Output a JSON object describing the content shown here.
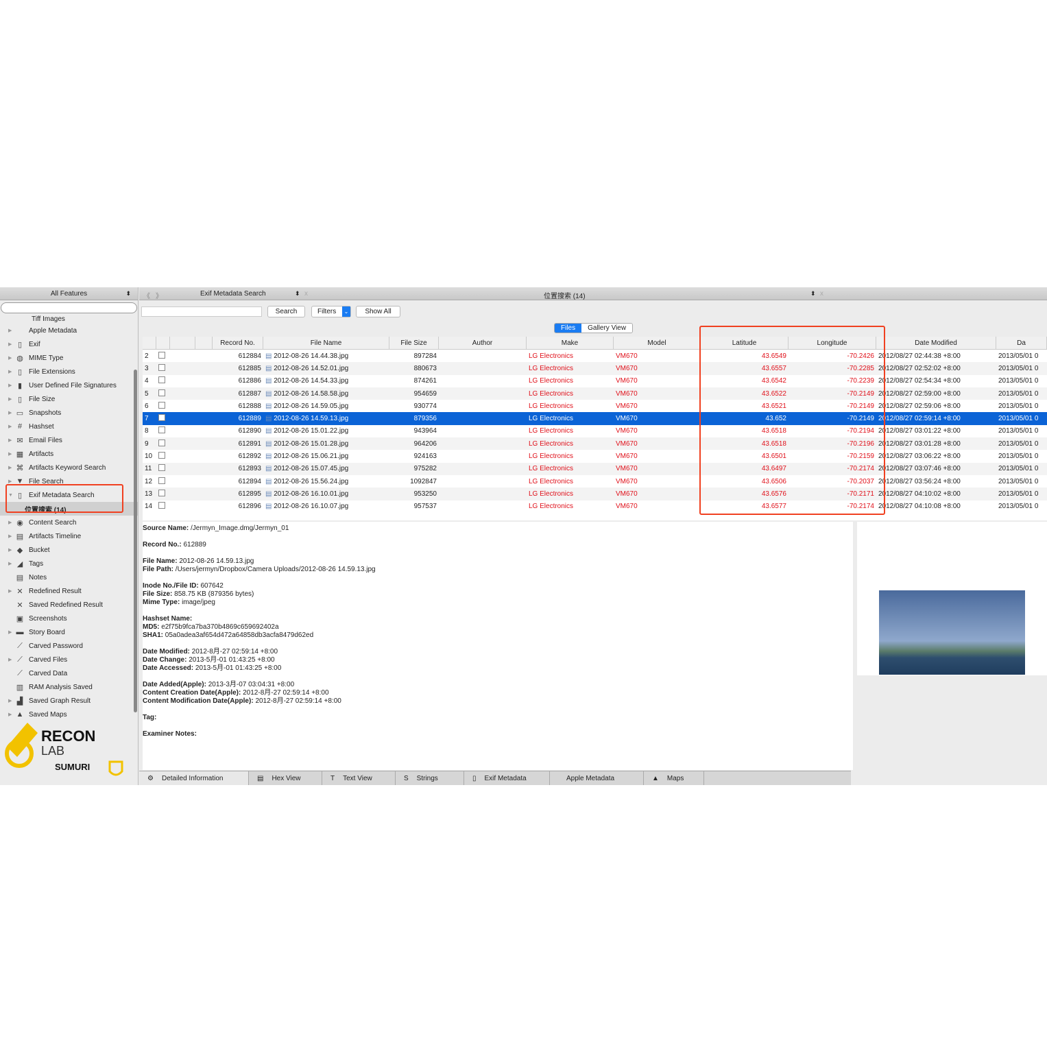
{
  "sidebar": {
    "title": "All Features",
    "partial_item": "Tiff Images",
    "items": [
      {
        "label": "Apple Metadata",
        "icon": "apple-icon",
        "g": ""
      },
      {
        "label": "Exif",
        "icon": "file-icon",
        "g": "▯"
      },
      {
        "label": "MIME Type",
        "icon": "globe-icon",
        "g": "◍"
      },
      {
        "label": "File Extensions",
        "icon": "document-icon",
        "g": "▯"
      },
      {
        "label": "User Defined File Signatures",
        "icon": "document-icon",
        "g": "▮"
      },
      {
        "label": "File Size",
        "icon": "document-icon",
        "g": "▯"
      },
      {
        "label": "Snapshots",
        "icon": "monitor-icon",
        "g": "▭"
      },
      {
        "label": "Hashset",
        "icon": "hash-icon",
        "g": "#"
      },
      {
        "label": "Email Files",
        "icon": "envelope-icon",
        "g": "✉"
      },
      {
        "label": "Artifacts",
        "icon": "grid-icon",
        "g": "▦"
      },
      {
        "label": "Artifacts Keyword Search",
        "icon": "keyword-icon",
        "g": "⌘"
      },
      {
        "label": "File Search",
        "icon": "filter-icon",
        "g": "▼"
      },
      {
        "label": "Exif Metadata Search",
        "icon": "document-icon",
        "g": "▯",
        "expanded": true
      },
      {
        "label": "位置搜索 (14)",
        "sub": true
      },
      {
        "label": "Content Search",
        "icon": "eye-icon",
        "g": "◉"
      },
      {
        "label": "Artifacts Timeline",
        "icon": "timeline-icon",
        "g": "▤"
      },
      {
        "label": "Bucket",
        "icon": "bucket-icon",
        "g": "◆"
      },
      {
        "label": "Tags",
        "icon": "tag-icon",
        "g": "◢"
      },
      {
        "label": "Notes",
        "icon": "notes-icon",
        "g": "▤",
        "leaf": true
      },
      {
        "label": "Redefined Result",
        "icon": "redefined-icon",
        "g": "✕"
      },
      {
        "label": "Saved Redefined Result",
        "icon": "redefined-icon",
        "g": "✕",
        "leaf": true
      },
      {
        "label": "Screenshots",
        "icon": "screenshot-icon",
        "g": "▣",
        "leaf": true
      },
      {
        "label": "Story Board",
        "icon": "storyboard-icon",
        "g": "▬"
      },
      {
        "label": "Carved Password",
        "icon": "chart-icon",
        "g": "⟋",
        "leaf": true
      },
      {
        "label": "Carved Files",
        "icon": "chart-icon",
        "g": "⟋"
      },
      {
        "label": "Carved Data",
        "icon": "chart-icon",
        "g": "⟋",
        "leaf": true
      },
      {
        "label": "RAM Analysis Saved",
        "icon": "ram-icon",
        "g": "▥",
        "leaf": true
      },
      {
        "label": "Saved Graph Result",
        "icon": "graph-icon",
        "g": "▟"
      },
      {
        "label": "Saved Maps",
        "icon": "map-icon",
        "g": "▲"
      }
    ]
  },
  "logo": {
    "text1": "RECON",
    "text2": "LAB",
    "text3": "SUMURI"
  },
  "tabs": {
    "first": "Exif Metadata Search",
    "second": "位置搜索 (14)",
    "close": "x"
  },
  "toolbar": {
    "search": "Search",
    "filters": "Filters",
    "show_all": "Show All",
    "search_placeholder": ""
  },
  "views": {
    "files": "Files",
    "gallery": "Gallery View"
  },
  "table": {
    "columns": [
      "",
      "",
      "",
      "",
      "Record No.",
      "File Name",
      "File Size",
      "Author",
      "Make",
      "Model",
      "Latitude",
      "Longitude",
      "Date Modified",
      "Da"
    ],
    "rows": [
      [
        "2",
        "612884",
        "2012-08-26 14.44.38.jpg",
        "897284",
        "",
        "LG Electronics",
        "VM670",
        "43.6549",
        "-70.2426",
        "2012/08/27 02:44:38 +8:00",
        "2013/05/01 0"
      ],
      [
        "3",
        "612885",
        "2012-08-26 14.52.01.jpg",
        "880673",
        "",
        "LG Electronics",
        "VM670",
        "43.6557",
        "-70.2285",
        "2012/08/27 02:52:02 +8:00",
        "2013/05/01 0"
      ],
      [
        "4",
        "612886",
        "2012-08-26 14.54.33.jpg",
        "874261",
        "",
        "LG Electronics",
        "VM670",
        "43.6542",
        "-70.2239",
        "2012/08/27 02:54:34 +8:00",
        "2013/05/01 0"
      ],
      [
        "5",
        "612887",
        "2012-08-26 14.58.58.jpg",
        "954659",
        "",
        "LG Electronics",
        "VM670",
        "43.6522",
        "-70.2149",
        "2012/08/27 02:59:00 +8:00",
        "2013/05/01 0"
      ],
      [
        "6",
        "612888",
        "2012-08-26 14.59.05.jpg",
        "930774",
        "",
        "LG Electronics",
        "VM670",
        "43.6521",
        "-70.2149",
        "2012/08/27 02:59:06 +8:00",
        "2013/05/01 0"
      ],
      [
        "7",
        "612889",
        "2012-08-26 14.59.13.jpg",
        "879356",
        "",
        "LG Electronics",
        "VM670",
        "43.652",
        "-70.2149",
        "2012/08/27 02:59:14 +8:00",
        "2013/05/01 0"
      ],
      [
        "8",
        "612890",
        "2012-08-26 15.01.22.jpg",
        "943964",
        "",
        "LG Electronics",
        "VM670",
        "43.6518",
        "-70.2194",
        "2012/08/27 03:01:22 +8:00",
        "2013/05/01 0"
      ],
      [
        "9",
        "612891",
        "2012-08-26 15.01.28.jpg",
        "964206",
        "",
        "LG Electronics",
        "VM670",
        "43.6518",
        "-70.2196",
        "2012/08/27 03:01:28 +8:00",
        "2013/05/01 0"
      ],
      [
        "10",
        "612892",
        "2012-08-26 15.06.21.jpg",
        "924163",
        "",
        "LG Electronics",
        "VM670",
        "43.6501",
        "-70.2159",
        "2012/08/27 03:06:22 +8:00",
        "2013/05/01 0"
      ],
      [
        "11",
        "612893",
        "2012-08-26 15.07.45.jpg",
        "975282",
        "",
        "LG Electronics",
        "VM670",
        "43.6497",
        "-70.2174",
        "2012/08/27 03:07:46 +8:00",
        "2013/05/01 0"
      ],
      [
        "12",
        "612894",
        "2012-08-26 15.56.24.jpg",
        "1092847",
        "",
        "LG Electronics",
        "VM670",
        "43.6506",
        "-70.2037",
        "2012/08/27 03:56:24 +8:00",
        "2013/05/01 0"
      ],
      [
        "13",
        "612895",
        "2012-08-26 16.10.01.jpg",
        "953250",
        "",
        "LG Electronics",
        "VM670",
        "43.6576",
        "-70.2171",
        "2012/08/27 04:10:02 +8:00",
        "2013/05/01 0"
      ],
      [
        "14",
        "612896",
        "2012-08-26 16.10.07.jpg",
        "957537",
        "",
        "LG Electronics",
        "VM670",
        "43.6577",
        "-70.2174",
        "2012/08/27 04:10:08 +8:00",
        "2013/05/01 0"
      ]
    ],
    "selected_row": "7"
  },
  "detail": [
    [
      "Source Name:",
      "/Jermyn_Image.dmg/Jermyn_01"
    ],
    null,
    [
      "Record No.:",
      "612889"
    ],
    null,
    [
      "File Name:",
      "2012-08-26 14.59.13.jpg"
    ],
    [
      "File Path:",
      "/Users/jermyn/Dropbox/Camera Uploads/2012-08-26 14.59.13.jpg"
    ],
    null,
    [
      "Inode No./File ID:",
      "607642"
    ],
    [
      "File Size:",
      "858.75 KB (879356 bytes)"
    ],
    [
      "Mime Type:",
      "image/jpeg"
    ],
    null,
    [
      "Hashset Name:",
      ""
    ],
    [
      "MD5:",
      "e2f75b9fca7ba370b4869c659692402a"
    ],
    [
      "SHA1:",
      "05a0adea3af654d472a64858db3acfa8479d62ed"
    ],
    null,
    [
      "Date Modified:",
      "2012-8月-27 02:59:14 +8:00"
    ],
    [
      "Date Change:",
      "2013-5月-01 01:43:25 +8:00"
    ],
    [
      "Date Accessed:",
      "2013-5月-01 01:43:25 +8:00"
    ],
    null,
    [
      "Date Added(Apple):",
      "2013-3月-07 03:04:31 +8:00"
    ],
    [
      "Content Creation Date(Apple):",
      "2012-8月-27 02:59:14 +8:00"
    ],
    [
      "Content Modification Date(Apple):",
      "2012-8月-27 02:59:14 +8:00"
    ],
    null,
    [
      "Tag:",
      ""
    ],
    null,
    [
      "Examiner Notes:",
      ""
    ]
  ],
  "bottom_tabs": [
    {
      "label": "Detailed Information",
      "g": "⚙",
      "icon": "gear-icon",
      "w": 160
    },
    {
      "label": "Hex View",
      "g": "▤",
      "icon": "hex-icon",
      "w": 107
    },
    {
      "label": "Text View",
      "g": "T",
      "icon": "text-icon",
      "w": 107
    },
    {
      "label": "Strings",
      "g": "S",
      "icon": "strings-icon",
      "w": 100
    },
    {
      "label": "Exif Metadata",
      "g": "▯",
      "icon": "document-icon",
      "w": 125
    },
    {
      "label": "Apple Metadata",
      "g": "",
      "icon": "apple-icon",
      "w": 137
    },
    {
      "label": "Maps",
      "g": "▲",
      "icon": "map-icon",
      "w": 88
    }
  ],
  "colors": {
    "selection": "#0b63d6",
    "highlight": "#f04020",
    "value_red": "#e0101a"
  }
}
